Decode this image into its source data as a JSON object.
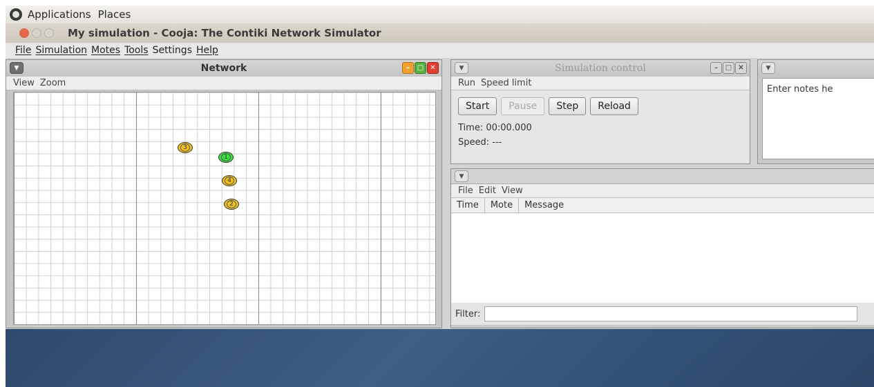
{
  "top_panel": {
    "applications": "Applications",
    "places": "Places"
  },
  "window": {
    "title": "My simulation - Cooja: The Contiki Network Simulator"
  },
  "menubar": [
    "File",
    "Simulation",
    "Motes",
    "Tools",
    "Settings",
    "Help"
  ],
  "network": {
    "title": "Network",
    "menu": [
      "View",
      "Zoom"
    ],
    "motes": [
      {
        "id": "3",
        "color": "yellow"
      },
      {
        "id": "1",
        "color": "green"
      },
      {
        "id": "4",
        "color": "yellow"
      },
      {
        "id": "2",
        "color": "yellow"
      }
    ]
  },
  "sim_control": {
    "title": "Simulation control",
    "menu": [
      "Run",
      "Speed limit"
    ],
    "buttons": {
      "start": "Start",
      "pause": "Pause",
      "step": "Step",
      "reload": "Reload"
    },
    "time": "Time: 00:00.000",
    "speed": "Speed: ---"
  },
  "notes": {
    "placeholder": "Enter notes he"
  },
  "log": {
    "menu": [
      "File",
      "Edit",
      "View"
    ],
    "columns": [
      "Time",
      "Mote",
      "Message"
    ],
    "filter_label": "Filter:"
  },
  "colors": {
    "mote_yellow": "#f0c020",
    "mote_green": "#3ce040",
    "close_red": "#e04030"
  }
}
